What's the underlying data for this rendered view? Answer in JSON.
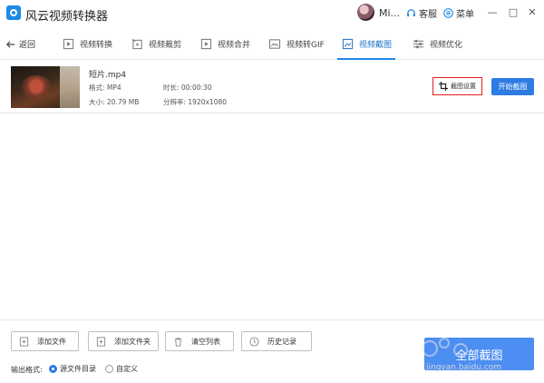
{
  "titlebar": {
    "app_title": "风云视频转换器",
    "user_name": "Mi...",
    "service_label": "客服",
    "menu_label": "菜单",
    "minimize": "—",
    "restore": "□",
    "close": "✕"
  },
  "toolbar": {
    "back_label": "返回",
    "tabs": [
      {
        "label": "视频转换",
        "icon": "video-convert-icon"
      },
      {
        "label": "视频裁剪",
        "icon": "video-trim-icon"
      },
      {
        "label": "视频合并",
        "icon": "video-merge-icon"
      },
      {
        "label": "视频转GIF",
        "icon": "gif-icon"
      },
      {
        "label": "视频截图",
        "icon": "crop-icon",
        "active": true
      },
      {
        "label": "视频优化",
        "icon": "sliders-icon"
      }
    ]
  },
  "file": {
    "name": "短片.mp4",
    "format": "格式: MP4",
    "duration": "时长: 00:00:30",
    "size": "大小: 20.79 MB",
    "resolution": "分辨率: 1920x1080",
    "crop_settings_label": "截图设置",
    "start_label": "开始截图"
  },
  "bottom": {
    "buttons": [
      "添加文件",
      "添加文件夹",
      "清空列表",
      "历史记录"
    ],
    "output_format_label": "输出格式:",
    "options": [
      {
        "label": "源文件目录",
        "selected": true
      },
      {
        "label": "自定义",
        "selected": false
      }
    ],
    "big_button_label": "全部截图"
  },
  "watermark": {
    "text": "jingyan.baidu.com"
  },
  "colors": {
    "accent": "#1e88e5",
    "button_blue": "#2f7be4",
    "highlight_red": "#e02020"
  }
}
